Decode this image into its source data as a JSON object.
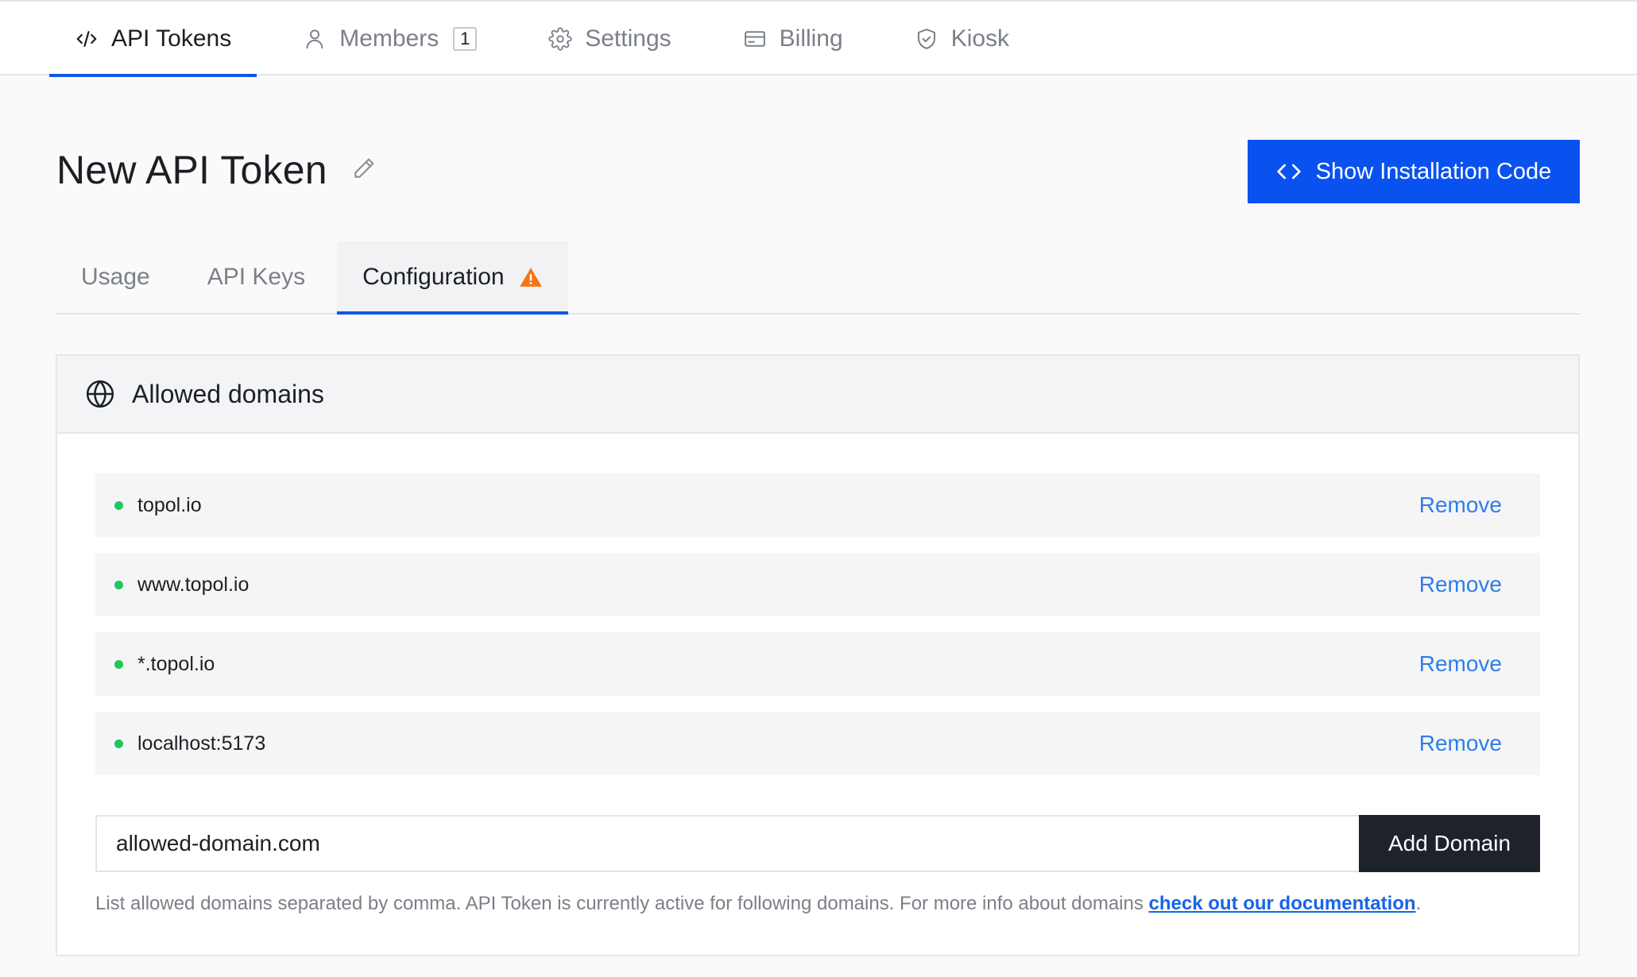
{
  "topnav": {
    "tabs": [
      {
        "label": "API Tokens",
        "icon": "code-slash-icon",
        "active": true
      },
      {
        "label": "Members",
        "icon": "user-icon",
        "badge": "1",
        "active": false
      },
      {
        "label": "Settings",
        "icon": "gear-icon",
        "active": false
      },
      {
        "label": "Billing",
        "icon": "credit-card-icon",
        "active": false
      },
      {
        "label": "Kiosk",
        "icon": "shield-check-icon",
        "active": false
      }
    ]
  },
  "header": {
    "title": "New API Token",
    "install_button": "Show Installation Code"
  },
  "subtabs": [
    {
      "label": "Usage",
      "active": false
    },
    {
      "label": "API Keys",
      "active": false
    },
    {
      "label": "Configuration",
      "active": true,
      "warning": true
    }
  ],
  "allowed_domains": {
    "title": "Allowed domains",
    "status_color": "#22c55e",
    "items": [
      {
        "domain": "topol.io",
        "action": "Remove"
      },
      {
        "domain": "www.topol.io",
        "action": "Remove"
      },
      {
        "domain": "*.topol.io",
        "action": "Remove"
      },
      {
        "domain": "localhost:5173",
        "action": "Remove"
      }
    ],
    "input_value": "allowed-domain.com",
    "add_button": "Add Domain",
    "help_text": "List allowed domains separated by comma. API Token is currently active for following domains. For more info about domains ",
    "help_link": "check out our documentation",
    "help_suffix": "."
  },
  "colors": {
    "primary": "#0a52f0",
    "link": "#2f7dea",
    "warning": "#f97316",
    "dark_button": "#1e232b"
  }
}
